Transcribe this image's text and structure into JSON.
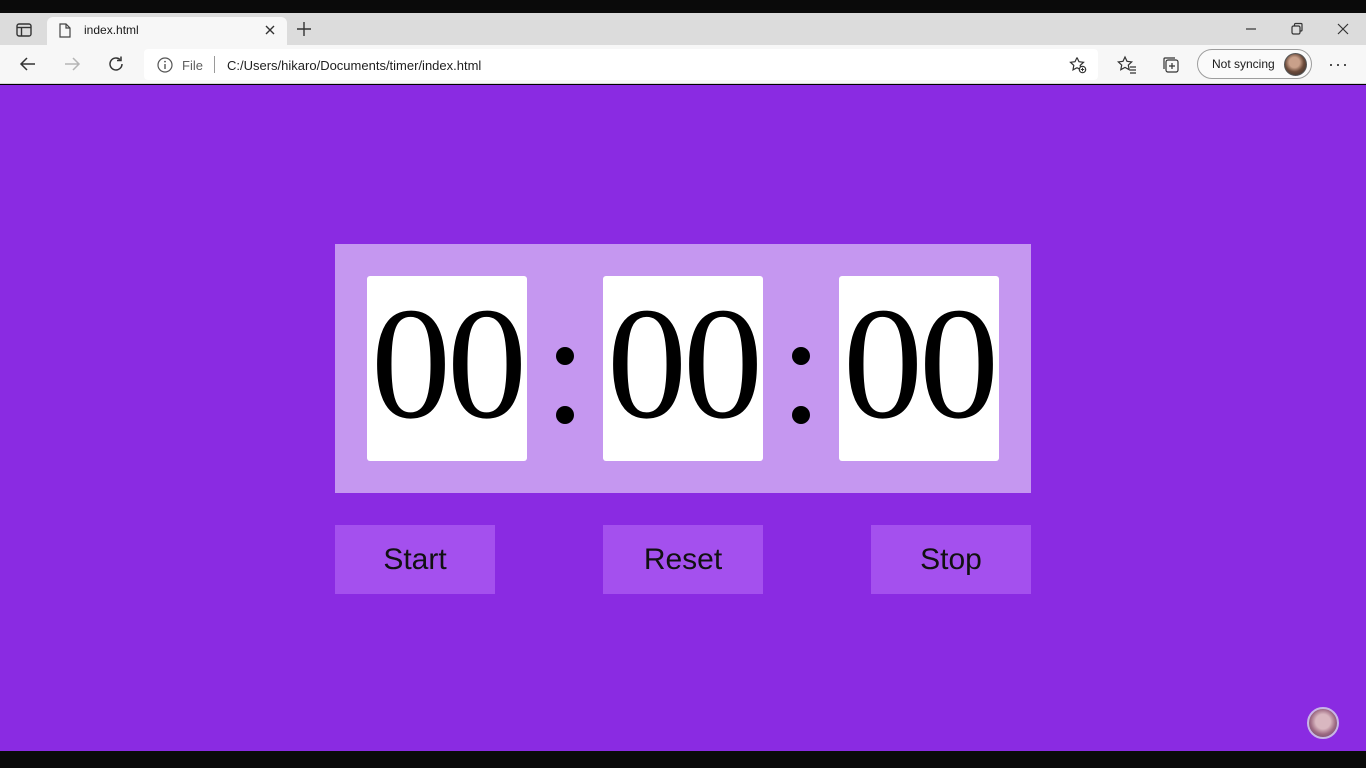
{
  "browser": {
    "tab_title": "index.html",
    "address": {
      "scheme_label": "File",
      "url": "C:/Users/hikaro/Documents/timer/index.html"
    },
    "sync_label": "Not syncing",
    "icons": [
      "tab-actions-icon",
      "page-icon",
      "close-icon",
      "plus-icon",
      "minimize-icon",
      "restore-icon",
      "window-close-icon",
      "back-icon",
      "forward-icon",
      "refresh-icon",
      "info-icon",
      "add-favorite-icon",
      "favorites-icon",
      "collections-icon",
      "profile-avatar",
      "more-icon"
    ]
  },
  "timer": {
    "hours": "00",
    "minutes": "00",
    "seconds": "00"
  },
  "controls": {
    "start_label": "Start",
    "reset_label": "Reset",
    "stop_label": "Stop"
  },
  "colors": {
    "page_background": "#8a2be2",
    "panel_background": "#c597f0",
    "button_background": "#a450ee"
  }
}
